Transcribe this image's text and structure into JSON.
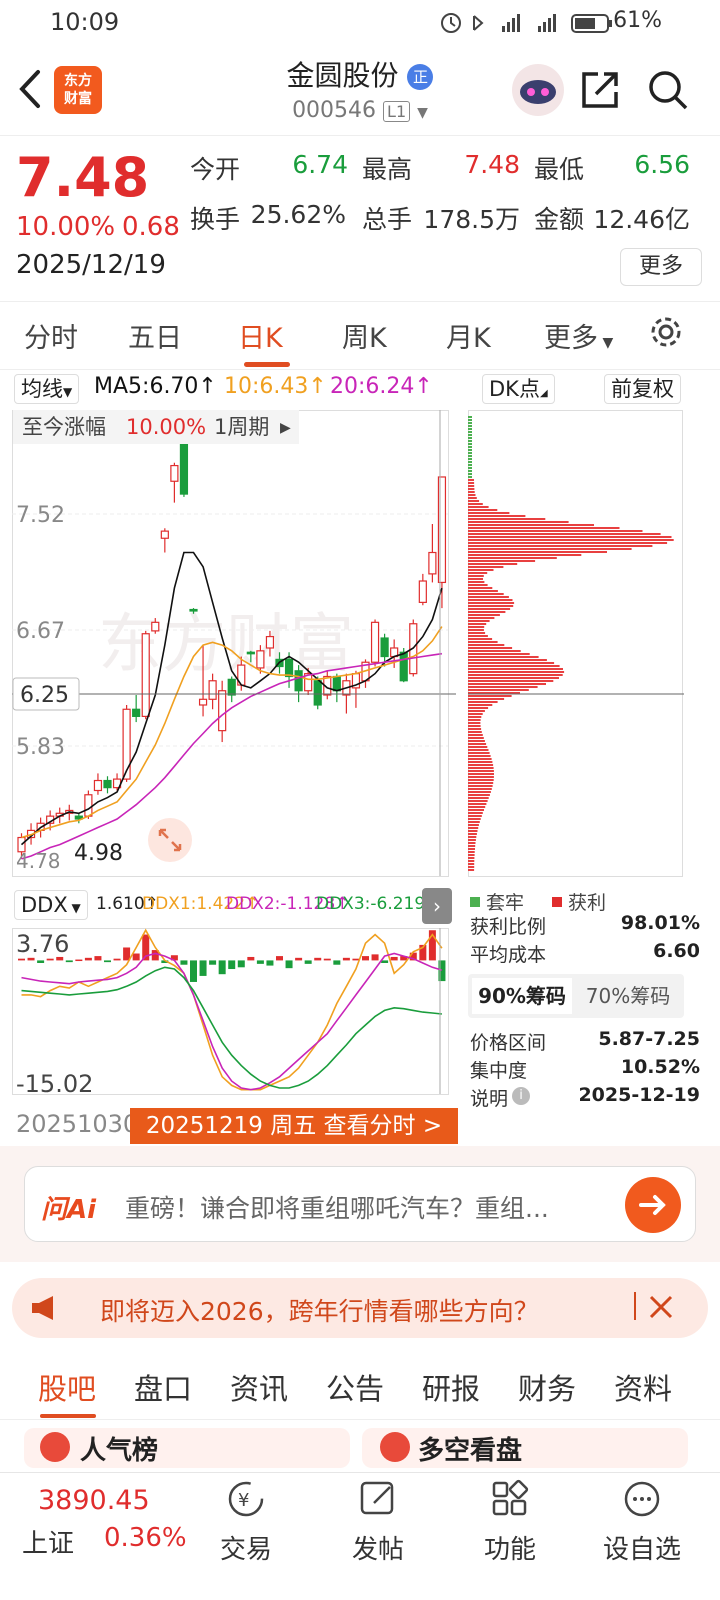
{
  "status": {
    "time": "10:09",
    "battery": "61%"
  },
  "header": {
    "logo_text": "东方财富",
    "stock_name": "金圆股份",
    "badge": "正",
    "code": "000546",
    "level": "L1"
  },
  "quote": {
    "price": "7.48",
    "change_pct": "10.00%",
    "change": "0.68",
    "date": "2025/12/19",
    "open_label": "今开",
    "open": "6.74",
    "high_label": "最高",
    "high": "7.48",
    "low_label": "最低",
    "low": "6.56",
    "turnover_label": "换手",
    "turnover": "25.62%",
    "volume_label": "总手",
    "volume": "178.5万",
    "amount_label": "金额",
    "amount": "12.46亿",
    "more": "更多"
  },
  "tabs": [
    "分时",
    "五日",
    "日K",
    "周K",
    "月K",
    "更多"
  ],
  "active_tab": "日K",
  "chart_bar": {
    "ma_select": "均线",
    "ma5": "MA5:6.70↑",
    "ma10": "10:6.43↑",
    "ma20": "20:6.24↑",
    "dk": "DK点",
    "fq": "前复权",
    "period_label": "至今涨幅",
    "period_value": "10.00%",
    "period": "1周期"
  },
  "chart_labels": {
    "y_top": "7.52",
    "y_mid": "6.67",
    "y_cross": "6.25",
    "y_low": "5.83",
    "y_min": "4.78",
    "y_min_val": "4.98",
    "watermark": "东方财富"
  },
  "ddx": {
    "name": "DDX",
    "v": "1.610↑",
    "ddx1": "DDX1:1.422↑",
    "ddx2": "DDX2:-1.128↑",
    "ddx3": "DDX3:-6.219↑",
    "y_top": "3.76",
    "y_bot": "-15.02",
    "start_date": "20251030",
    "banner": "20251219 周五 查看分时 >"
  },
  "chips": {
    "legend_trap": "套牢",
    "legend_profit": "获利",
    "profit_ratio_label": "获利比例",
    "profit_ratio": "98.01%",
    "avg_cost_label": "平均成本",
    "avg_cost": "6.60",
    "tab90": "90%筹码",
    "tab70": "70%筹码",
    "range_label": "价格区间",
    "range": "5.87-7.25",
    "conc_label": "集中度",
    "conc": "10.52%",
    "note_label": "说明",
    "note_date": "2025-12-19"
  },
  "ai": {
    "logo": "问Ai",
    "text": "重磅！谦合即将重组哪吒汽车？重组..."
  },
  "notice": {
    "text": "即将迈入2026，跨年行情看哪些方向？"
  },
  "tabs2": [
    "股吧",
    "盘口",
    "资讯",
    "公告",
    "研报",
    "财务",
    "资料"
  ],
  "cards": {
    "left": "人气榜",
    "right": "多空看盘"
  },
  "bottom": {
    "index_value": "3890.45",
    "index_name": "上证",
    "index_pct": "0.36%",
    "trade": "交易",
    "post": "发帖",
    "func": "功能",
    "watch": "设自选"
  },
  "colors": {
    "up": "#e02d2d",
    "down": "#1a9d3c",
    "accent": "#e04d21",
    "ma5": "#111111",
    "ma10": "#f0a020",
    "ma20": "#c825b8"
  },
  "chart_data": {
    "type": "candlestick",
    "ylim": [
      4.68,
      7.95
    ],
    "candles": [
      [
        4.85,
        4.95,
        4.8,
        4.98
      ],
      [
        4.95,
        5.0,
        4.9,
        5.05
      ],
      [
        5.0,
        5.05,
        4.95,
        5.09
      ],
      [
        5.05,
        5.1,
        5.0,
        5.14
      ],
      [
        5.1,
        5.12,
        5.05,
        5.16
      ],
      [
        5.12,
        5.14,
        5.07,
        5.18
      ],
      [
        5.1,
        5.08,
        5.05,
        5.12
      ],
      [
        5.1,
        5.25,
        5.08,
        5.28
      ],
      [
        5.28,
        5.35,
        5.25,
        5.4
      ],
      [
        5.35,
        5.3,
        5.26,
        5.38
      ],
      [
        5.3,
        5.36,
        5.28,
        5.4
      ],
      [
        5.36,
        5.85,
        5.34,
        5.88
      ],
      [
        5.85,
        5.8,
        5.76,
        5.95
      ],
      [
        5.8,
        6.38,
        5.78,
        6.4
      ],
      [
        6.4,
        6.46,
        6.38,
        6.49
      ],
      [
        7.05,
        7.1,
        6.95,
        7.12
      ],
      [
        7.45,
        7.56,
        7.3,
        7.58
      ],
      [
        8.0,
        7.36,
        7.34,
        8.02
      ],
      [
        6.55,
        6.54,
        6.52,
        6.56
      ],
      [
        5.88,
        5.92,
        5.8,
        6.3
      ],
      [
        5.92,
        6.05,
        5.85,
        6.1
      ],
      [
        5.7,
        5.98,
        5.62,
        6.05
      ],
      [
        6.06,
        5.95,
        5.9,
        6.08
      ],
      [
        6.02,
        6.16,
        5.98,
        6.22
      ],
      [
        6.25,
        6.24,
        6.18,
        6.26
      ],
      [
        6.14,
        6.26,
        6.1,
        6.3
      ],
      [
        6.28,
        6.36,
        6.22,
        6.4
      ],
      [
        6.2,
        6.15,
        6.1,
        6.25
      ],
      [
        6.2,
        6.08,
        6.0,
        6.25
      ],
      [
        6.12,
        5.98,
        5.9,
        6.16
      ],
      [
        5.98,
        6.1,
        5.95,
        6.14
      ],
      [
        6.05,
        5.88,
        5.85,
        6.08
      ],
      [
        5.95,
        6.08,
        5.92,
        6.12
      ],
      [
        6.08,
        5.98,
        5.9,
        6.1
      ],
      [
        5.95,
        6.05,
        5.82,
        6.1
      ],
      [
        6.0,
        6.1,
        5.86,
        6.12
      ],
      [
        6.05,
        6.18,
        6.0,
        6.2
      ],
      [
        6.18,
        6.46,
        6.15,
        6.48
      ],
      [
        6.35,
        6.22,
        6.15,
        6.38
      ],
      [
        6.22,
        6.28,
        6.14,
        6.34
      ],
      [
        6.25,
        6.05,
        6.04,
        6.28
      ],
      [
        6.1,
        6.45,
        6.08,
        6.48
      ],
      [
        6.6,
        6.75,
        6.58,
        6.8
      ],
      [
        6.8,
        6.95,
        6.74,
        7.15
      ],
      [
        6.74,
        7.48,
        6.56,
        7.48
      ]
    ],
    "ma5": [
      4.9,
      4.96,
      5.02,
      5.06,
      5.1,
      5.13,
      5.12,
      5.15,
      5.2,
      5.23,
      5.27,
      5.42,
      5.55,
      5.75,
      5.95,
      6.3,
      6.7,
      6.95,
      6.95,
      6.85,
      6.6,
      6.35,
      6.12,
      6.02,
      6.0,
      6.05,
      6.1,
      6.18,
      6.22,
      6.18,
      6.12,
      6.06,
      6.0,
      5.98,
      6.0,
      6.02,
      6.05,
      6.1,
      6.18,
      6.22,
      6.24,
      6.28,
      6.36,
      6.48,
      6.7
    ],
    "ma10": [
      4.95,
      4.97,
      5.0,
      5.02,
      5.04,
      5.06,
      5.07,
      5.1,
      5.14,
      5.17,
      5.2,
      5.28,
      5.36,
      5.48,
      5.6,
      5.75,
      5.92,
      6.08,
      6.22,
      6.3,
      6.32,
      6.3,
      6.26,
      6.2,
      6.16,
      6.12,
      6.1,
      6.09,
      6.09,
      6.08,
      6.06,
      6.06,
      6.07,
      6.08,
      6.09,
      6.1,
      6.12,
      6.14,
      6.16,
      6.18,
      6.2,
      6.22,
      6.26,
      6.33,
      6.43
    ],
    "ma20": [
      4.8,
      4.82,
      4.85,
      4.88,
      4.9,
      4.93,
      4.96,
      4.99,
      5.02,
      5.05,
      5.08,
      5.13,
      5.18,
      5.24,
      5.3,
      5.37,
      5.45,
      5.53,
      5.61,
      5.68,
      5.75,
      5.81,
      5.86,
      5.9,
      5.94,
      5.97,
      6.0,
      6.03,
      6.05,
      6.07,
      6.09,
      6.1,
      6.12,
      6.13,
      6.14,
      6.15,
      6.16,
      6.17,
      6.18,
      6.19,
      6.2,
      6.21,
      6.22,
      6.23,
      6.24
    ],
    "ddx_bars": [
      0.2,
      0.3,
      -0.3,
      0.2,
      0.4,
      -0.2,
      0.1,
      0.3,
      0.5,
      -0.2,
      0.2,
      1.5,
      0.8,
      3.0,
      1.2,
      -0.3,
      0.6,
      -0.5,
      -2.5,
      -1.8,
      -0.5,
      -1.6,
      -1.0,
      -0.8,
      0.4,
      -0.4,
      -0.6,
      0.5,
      -0.9,
      0.3,
      -0.4,
      0.3,
      0.2,
      -0.5,
      0.3,
      0.2,
      0.5,
      0.7,
      -0.3,
      0.4,
      0.5,
      0.9,
      1.8,
      3.5,
      -2.4
    ],
    "ddx1": [
      -4.0,
      -4.0,
      -4.2,
      -3.5,
      -3.0,
      -3.2,
      -2.5,
      -3.0,
      -2.5,
      -2.0,
      -1.5,
      -0.5,
      1.5,
      3.5,
      1.5,
      0,
      -0.6,
      -1.5,
      -4.0,
      -7.5,
      -11.0,
      -13.5,
      -14.5,
      -15.0,
      -15.0,
      -15.0,
      -14.5,
      -14.0,
      -13.5,
      -12.5,
      -11.0,
      -9.5,
      -7.5,
      -5.0,
      -3.0,
      -1.0,
      2.0,
      3.0,
      2.0,
      -1.5,
      -0.5,
      1.0,
      1.5,
      3.0,
      1.42
    ],
    "ddx2": [
      -2.0,
      -2.2,
      -2.4,
      -2.5,
      -2.6,
      -2.7,
      -2.5,
      -2.4,
      -2.3,
      -2.2,
      -2.0,
      -1.5,
      -0.8,
      0.5,
      0.8,
      0.5,
      0,
      -1.5,
      -4.0,
      -7.0,
      -10.0,
      -12.5,
      -14.0,
      -14.8,
      -15.0,
      -14.8,
      -14.2,
      -13.5,
      -12.5,
      -11.5,
      -10.5,
      -9.5,
      -8.5,
      -7.0,
      -5.5,
      -4.0,
      -2.5,
      -1.0,
      0.5,
      0.8,
      0.5,
      0.2,
      -0.3,
      -0.8,
      -1.13
    ],
    "ddx3": [
      -3.5,
      -3.6,
      -3.7,
      -3.8,
      -3.9,
      -4.0,
      -3.9,
      -3.8,
      -3.7,
      -3.6,
      -3.4,
      -3.0,
      -2.5,
      -1.8,
      -1.2,
      -0.8,
      -1.0,
      -2.0,
      -3.5,
      -5.5,
      -7.5,
      -9.5,
      -11.0,
      -12.2,
      -13.2,
      -14.0,
      -14.5,
      -14.8,
      -14.8,
      -14.5,
      -14.0,
      -13.2,
      -12.2,
      -11.0,
      -9.8,
      -8.5,
      -7.5,
      -6.5,
      -5.8,
      -5.5,
      -5.6,
      -5.8,
      -6.0,
      -6.1,
      -6.22
    ],
    "ddx_ylim": [
      -15.5,
      3.76
    ]
  }
}
